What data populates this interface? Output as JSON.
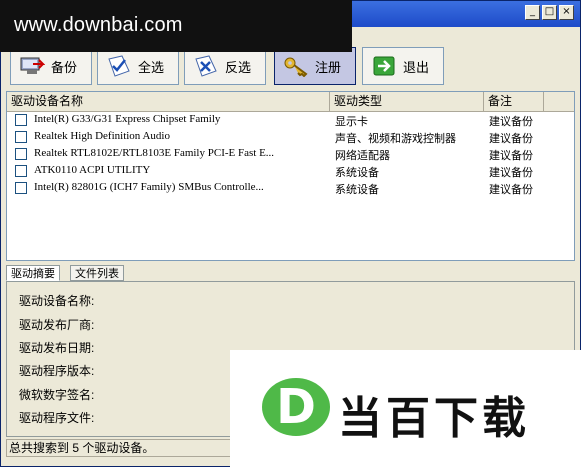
{
  "watermark": {
    "text": "www.downbai.com"
  },
  "window_controls": {
    "minimize": "_",
    "maximize": "□",
    "close": "×"
  },
  "toolbar": {
    "backup_label": "备份",
    "select_all_label": "全选",
    "invert_label": "反选",
    "register_label": "注册",
    "exit_label": "退出"
  },
  "list": {
    "columns": [
      "驱动设备名称",
      "驱动类型",
      "备注"
    ],
    "rows": [
      {
        "name": "Intel(R) G33/G31 Express Chipset Family",
        "type": "显示卡",
        "note": "建议备份"
      },
      {
        "name": "Realtek High Definition Audio",
        "type": "声音、视频和游戏控制器",
        "note": "建议备份"
      },
      {
        "name": "Realtek RTL8102E/RTL8103E Family PCI-E Fast E...",
        "type": "网络适配器",
        "note": "建议备份"
      },
      {
        "name": "ATK0110 ACPI UTILITY",
        "type": "系统设备",
        "note": "建议备份"
      },
      {
        "name": "Intel(R) 82801G (ICH7 Family) SMBus Controlle...",
        "type": "系统设备",
        "note": "建议备份"
      }
    ]
  },
  "tabs": [
    "驱动摘要",
    "文件列表"
  ],
  "details": {
    "device_name_label": "驱动设备名称:",
    "vendor_label": "驱动发布厂商:",
    "date_label": "驱动发布日期:",
    "version_label": "驱动程序版本:",
    "signature_label": "微软数字签名:",
    "file_label": "驱动程序文件:"
  },
  "status": {
    "text": "总共搜索到 5 个驱动设备。"
  },
  "logo": {
    "letter": "D",
    "brand": "当百下载",
    "circle_color": "#4fb948"
  }
}
